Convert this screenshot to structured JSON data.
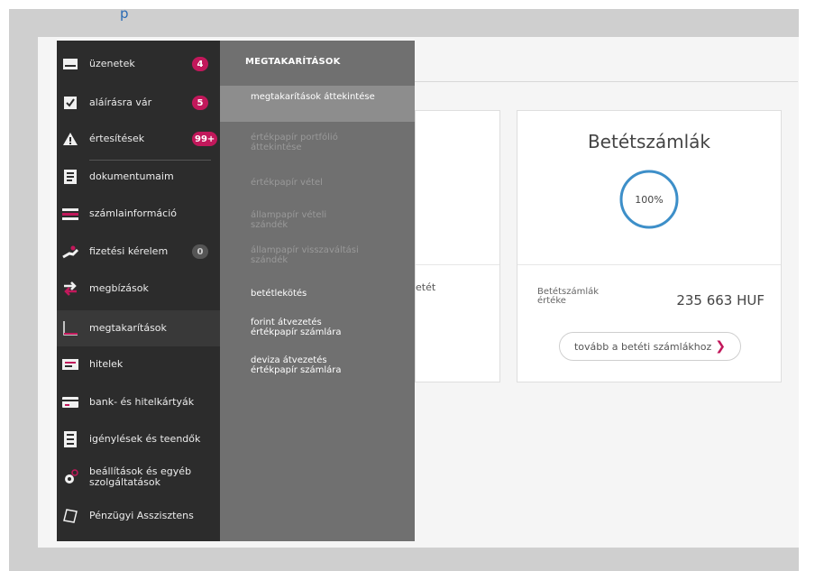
{
  "top_glyph": "p",
  "sidebar": {
    "items": [
      {
        "label": "üzenetek",
        "icon": "mail-icon",
        "badge": "4"
      },
      {
        "label": "aláírásra vár",
        "icon": "checkbox-icon",
        "badge": "5"
      },
      {
        "label": "értesítések",
        "icon": "warning-icon",
        "badge": "99+"
      },
      {
        "label": "dokumentumaim",
        "icon": "document-icon"
      },
      {
        "label": "számlainformáció",
        "icon": "account-info-icon"
      },
      {
        "label": "fizetési kérelem",
        "icon": "payment-request-icon",
        "badge": "0"
      },
      {
        "label": "megbízások",
        "icon": "transfer-icon"
      },
      {
        "label": "megtakarítások",
        "icon": "savings-chart-icon"
      },
      {
        "label": "hitelek",
        "icon": "loan-icon"
      },
      {
        "label": "bank- és hitelkártyák",
        "icon": "card-icon"
      },
      {
        "label": "igénylések és teendők",
        "icon": "checklist-icon"
      },
      {
        "label": "beállítások és egyéb szolgáltatások",
        "icon": "settings-icon"
      },
      {
        "label": "Pénzügyi Asszisztens",
        "icon": "assistant-icon"
      }
    ]
  },
  "submenu": {
    "title": "MEGTAKARÍTÁSOK",
    "items": [
      {
        "label": "megtakarítások áttekintése",
        "state": "highlighted"
      },
      {
        "label": "értékpapír portfólió áttekintése",
        "state": "disabled"
      },
      {
        "label": "értékpapír vétel",
        "state": "disabled"
      },
      {
        "label": "állampapír vételi szándék",
        "state": "disabled"
      },
      {
        "label": "állampapír visszaváltási szándék",
        "state": "disabled"
      },
      {
        "label": "betétlekötés",
        "state": "enabled"
      },
      {
        "label": "forint átvezetés értékpapír számlára",
        "state": "enabled"
      },
      {
        "label": "deviza átvezetés értékpapír számlára",
        "state": "enabled"
      }
    ]
  },
  "left_card": {
    "partial_text": "etét"
  },
  "deposit_card": {
    "title": "Betétszámlák",
    "percent": 100,
    "percent_label": "100%",
    "balance_label": "Betétszámlák értéke",
    "balance_value": "235 663 HUF",
    "button_label": "tovább a betéti számlákhoz"
  },
  "colors": {
    "sidebar_bg": "#2c2c2c",
    "submenu_bg": "#707070",
    "accent_badge": "#c2185b",
    "donut": "#3d8fc9"
  }
}
